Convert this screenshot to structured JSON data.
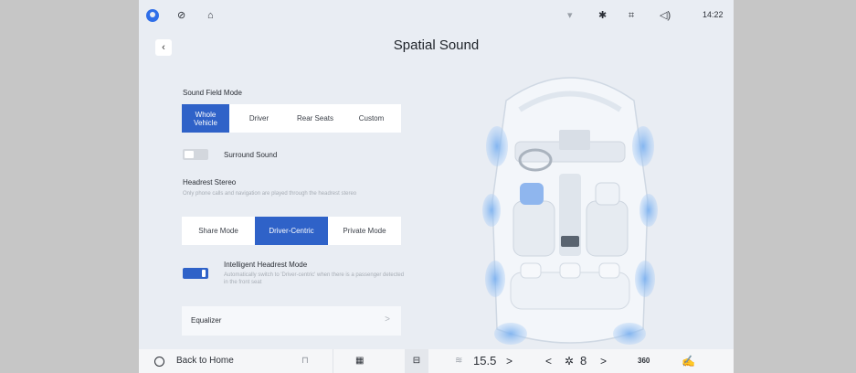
{
  "status_bar": {
    "icons": [
      "user-icon",
      "no-smoking-icon",
      "bell-icon",
      "signal-icon",
      "bluetooth-icon",
      "hotspot-icon",
      "volume-icon"
    ],
    "time": "14:22"
  },
  "header": {
    "back": "‹",
    "title": "Spatial Sound"
  },
  "sound_field": {
    "label": "Sound Field Mode",
    "options": [
      "Whole Vehicle",
      "Driver",
      "Rear Seats",
      "Custom"
    ],
    "selected": "Whole Vehicle"
  },
  "surround": {
    "label": "Surround Sound",
    "enabled": false
  },
  "headrest_stereo": {
    "label": "Headrest Stereo",
    "description": "Only phone calls and navigation are played through the headrest stereo",
    "options": [
      "Share Mode",
      "Driver-Centric",
      "Private Mode"
    ],
    "selected": "Driver-Centric"
  },
  "intelligent_headrest": {
    "label": "Intelligent Headrest Mode",
    "description": "Automatically switch to 'Driver-centric' when there is a passenger detected in the front seat",
    "enabled": true
  },
  "equalizer": {
    "label": "Equalizer",
    "chevron": ">"
  },
  "dock": {
    "back_home": "Back to Home",
    "temp_left": "15.5",
    "fan_level": "8",
    "view_360": "360",
    "lt": "<",
    "gt": ">"
  },
  "colors": {
    "accent": "#2f62c8",
    "background": "#e9edf3"
  }
}
